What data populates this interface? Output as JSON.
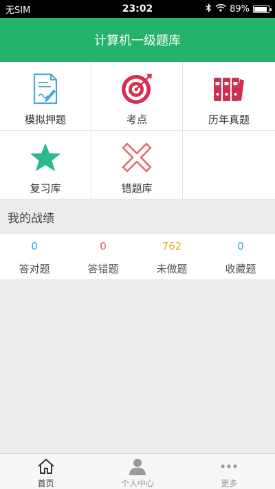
{
  "status_bar": {
    "carrier": "无SIM",
    "time": "23:02",
    "battery": "89%",
    "battery_level": 0.89
  },
  "header": {
    "title": "计算机一级题库"
  },
  "grid": [
    {
      "label": "模拟押题",
      "icon": "exam-paper-icon"
    },
    {
      "label": "考点",
      "icon": "target-icon"
    },
    {
      "label": "历年真题",
      "icon": "binders-icon"
    },
    {
      "label": "复习库",
      "icon": "star-icon"
    },
    {
      "label": "错题库",
      "icon": "cross-icon"
    }
  ],
  "section": {
    "title": "我的战绩"
  },
  "stats": [
    {
      "value": "0",
      "label": "答对题",
      "color": "#3a9bd8"
    },
    {
      "value": "0",
      "label": "答错题",
      "color": "#e0555a"
    },
    {
      "value": "762",
      "label": "未做题",
      "color": "#e0b21b"
    },
    {
      "value": "0",
      "label": "收藏题",
      "color": "#3a9bd8"
    }
  ],
  "tabs": [
    {
      "label": "首页",
      "icon": "home-icon",
      "active": true
    },
    {
      "label": "个人中心",
      "icon": "person-icon",
      "active": false
    },
    {
      "label": "更多",
      "icon": "more-icon",
      "active": false
    }
  ],
  "colors": {
    "brand": "#23b36a",
    "tab_active": "#333333",
    "tab_inactive": "#9a9a9a"
  }
}
